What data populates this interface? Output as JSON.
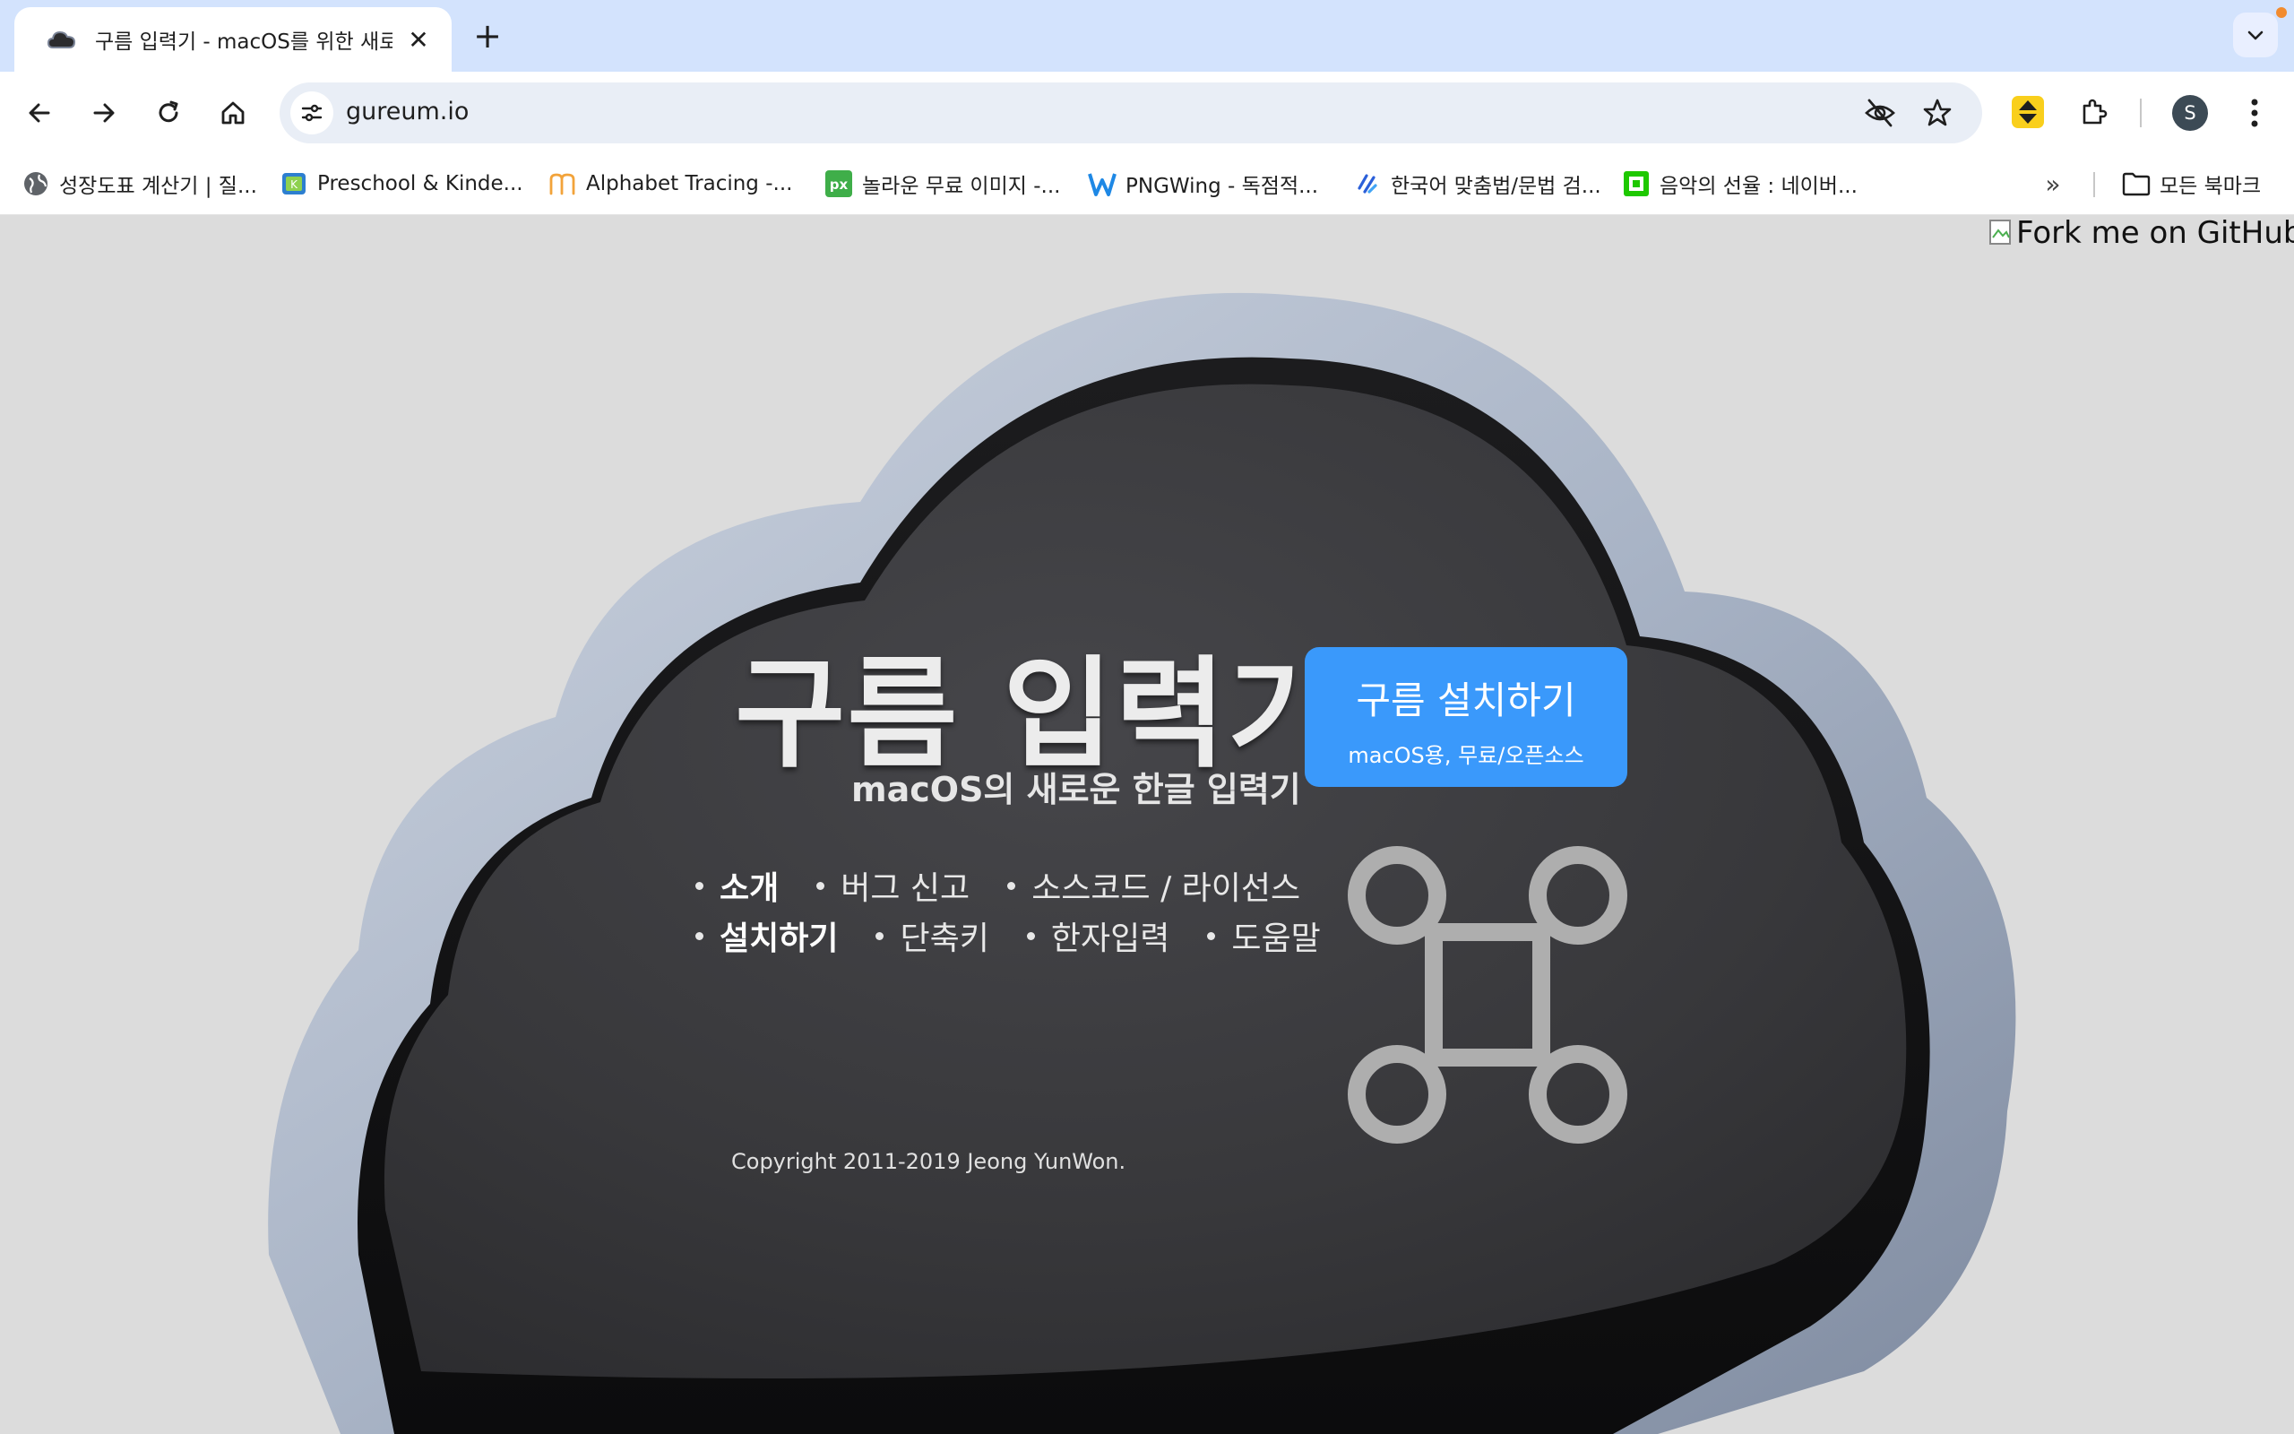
{
  "browser": {
    "tab": {
      "title": "구름 입력기 - macOS를 위한 새로운",
      "favicon": "cloud-icon"
    },
    "omnibox": {
      "url": "gureum.io"
    },
    "profile_initial": "S",
    "bookmarks": [
      {
        "label": "성장도표 계산기 | 질...",
        "icon": "globe-icon"
      },
      {
        "label": "Preschool & Kinde...",
        "icon": "kindergarten-favicon"
      },
      {
        "label": "Alphabet Tracing -...",
        "icon": "m-logo-icon"
      },
      {
        "label": "놀라운 무료 이미지 -...",
        "icon": "px-logo-icon"
      },
      {
        "label": "PNGWing - 독점적...",
        "icon": "w-logo-icon"
      },
      {
        "label": "한국어 맞춤법/문법 검...",
        "icon": "spellcheck-icon"
      },
      {
        "label": "음악의 선율 : 네이버...",
        "icon": "naver-icon"
      }
    ],
    "all_bookmarks_label": "모든 북마크"
  },
  "page": {
    "fork_ribbon_alt": "Fork me on GitHub",
    "title": "구름 입력기",
    "subtitle": "macOS의 새로운 한글 입력기",
    "install_button": {
      "main": "구름 설치하기",
      "sub": "macOS용, 무료/오픈소스"
    },
    "nav_row1": [
      "소개",
      "버그 신고",
      "소스코드 / 라이선스"
    ],
    "nav_row2": [
      "설치하기",
      "단축키",
      "한자입력",
      "도움말"
    ],
    "copyright": "Copyright 2011-2019 Jeong YunWon."
  },
  "colors": {
    "tabstrip": "#d3e3fd",
    "install_button": "#3a99fb",
    "cloud_face": "#3a3a3c",
    "cloud_rim": "#a9b4c6"
  }
}
